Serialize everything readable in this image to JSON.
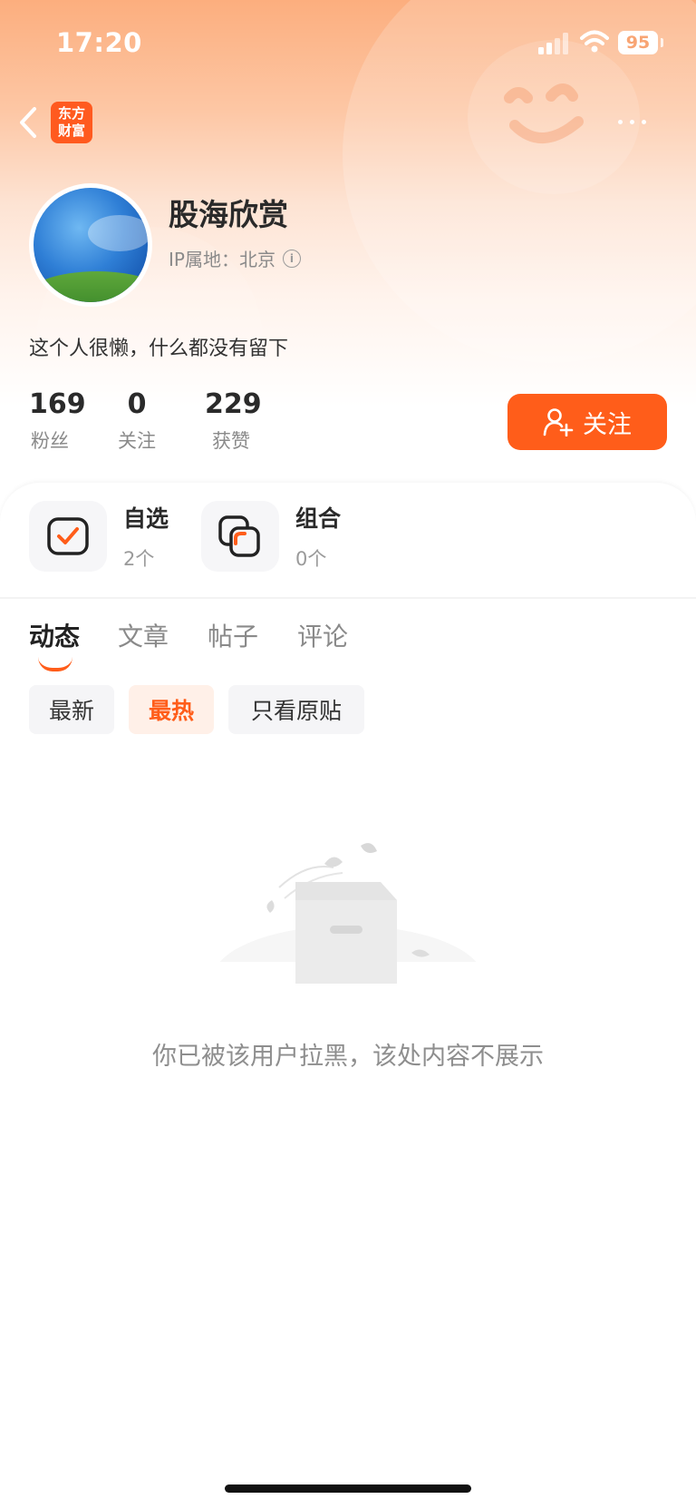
{
  "status_bar": {
    "time": "17:20",
    "battery": "95"
  },
  "header": {
    "app_logo_line1": "东方",
    "app_logo_line2": "财富"
  },
  "profile": {
    "name": "股海欣赏",
    "ip_location": "IP属地：北京",
    "bio": "这个人很懒，什么都没有留下",
    "stats": [
      {
        "value": "169",
        "label": "粉丝"
      },
      {
        "value": "0",
        "label": "关注"
      },
      {
        "value": "229",
        "label": "获赞"
      }
    ],
    "follow_label": "关注"
  },
  "quick_links": [
    {
      "title": "自选",
      "count": "2个",
      "icon": "checkbox-icon"
    },
    {
      "title": "组合",
      "count": "0个",
      "icon": "portfolio-icon"
    }
  ],
  "tabs": [
    {
      "label": "动态",
      "active": true
    },
    {
      "label": "文章",
      "active": false
    },
    {
      "label": "帖子",
      "active": false
    },
    {
      "label": "评论",
      "active": false
    }
  ],
  "filters": [
    {
      "label": "最新",
      "active": false
    },
    {
      "label": "最热",
      "active": true
    },
    {
      "label": "只看原贴",
      "active": false
    }
  ],
  "empty_state": {
    "message": "你已被该用户拉黑，该处内容不展示"
  },
  "colors": {
    "accent": "#ff5d1a",
    "hero_top": "#fcae7e"
  }
}
